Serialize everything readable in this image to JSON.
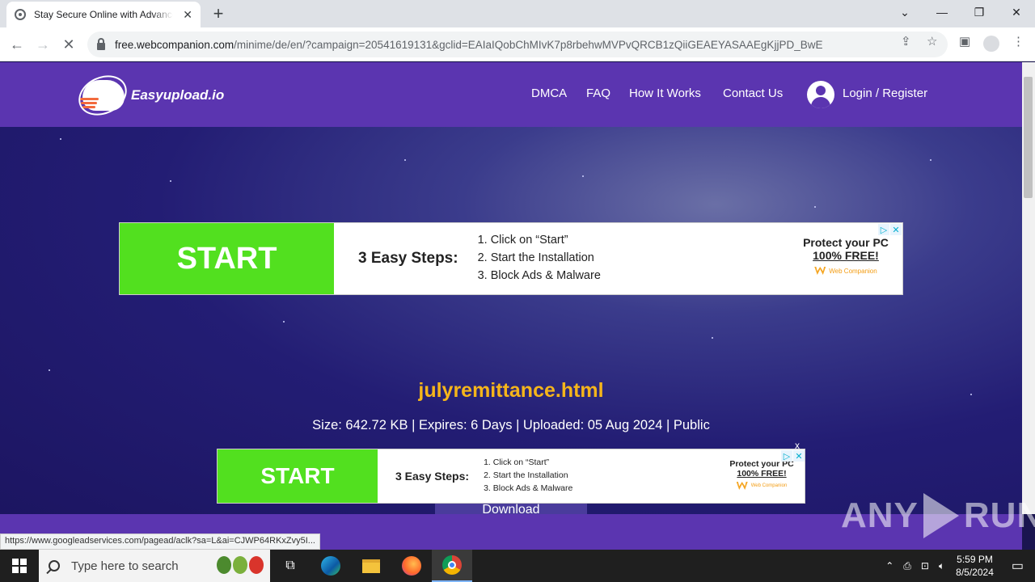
{
  "browser": {
    "tab_title": "Stay Secure Online with Advanced",
    "url_host": "free.webcompanion.com",
    "url_path": "/minime/de/en/?campaign=20541619131&gclid=EAIaIQobChMIvK7p8rbehwMVPvQRCB1zQiiGEAEYASAAEgKjjPD_BwE",
    "status_url": "https://www.googleadservices.com/pagead/aclk?sa=L&ai=CJWP64RKxZvy5I..."
  },
  "site": {
    "logo_text": "Easyupload.io",
    "nav": [
      "DMCA",
      "FAQ",
      "How It Works",
      "Contact Us"
    ],
    "login_label": "Login / Register"
  },
  "ad": {
    "start_label": "START",
    "steps_title": "3 Easy Steps:",
    "steps": [
      "1. Click on “Start”",
      "2. Start the Installation",
      "3. Block Ads & Malware"
    ],
    "protect_line1": "Protect your PC",
    "protect_line2": "100% FREE!",
    "brand": "Web Companion"
  },
  "file": {
    "name": "julyremittance.html",
    "meta": "Size: 642.72 KB | Expires: 6 Days | Uploaded: 05 Aug 2024 | Public",
    "download_label": "Download"
  },
  "watermark": {
    "left": "ANY",
    "right": "RUN"
  },
  "taskbar": {
    "search_placeholder": "Type here to search",
    "time": "5:59 PM",
    "date": "8/5/2024"
  },
  "colors": {
    "header": "#5b35b0",
    "accent_file": "#f5b51b",
    "ad_green": "#52e01f"
  }
}
